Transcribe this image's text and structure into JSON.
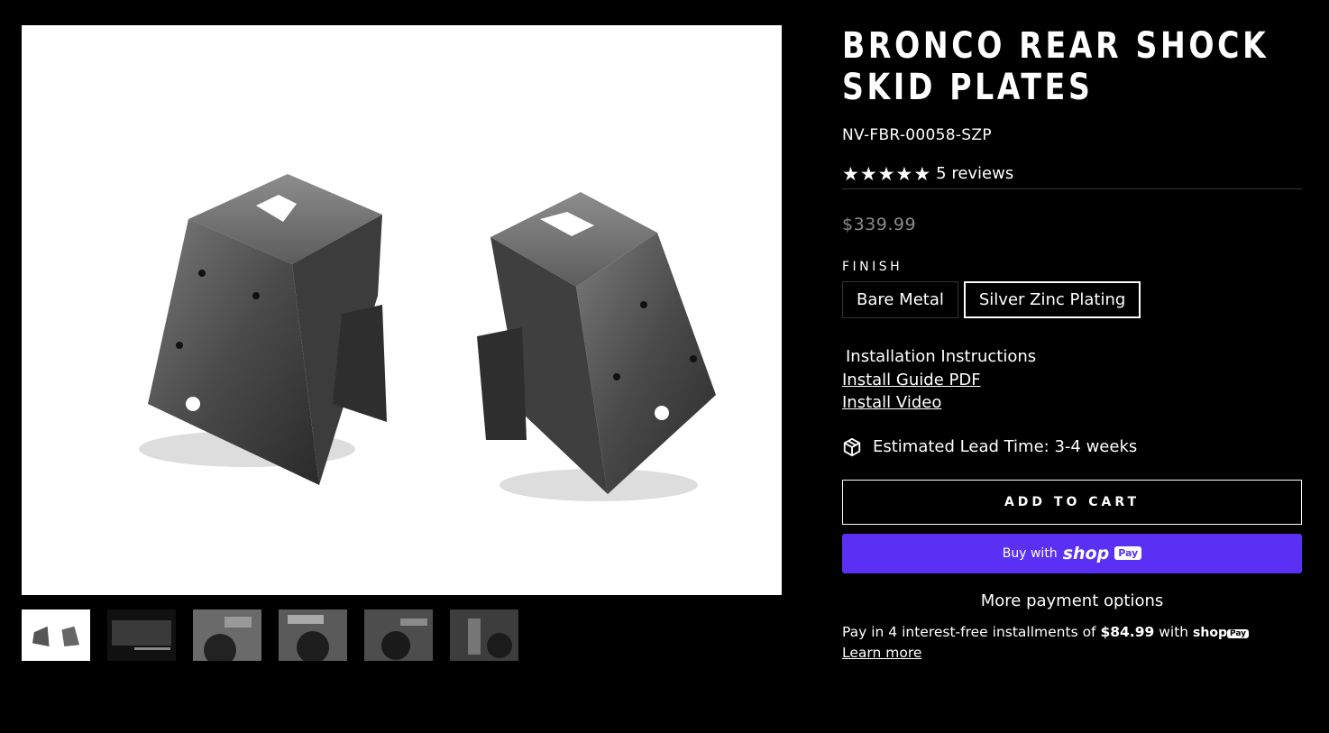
{
  "product": {
    "title": "BRONCO REAR SHOCK SKID PLATES",
    "sku": "NV-FBR-00058-SZP",
    "reviews_count": "5 reviews",
    "rating": 5,
    "price": "$339.99"
  },
  "finish": {
    "label": "FINISH",
    "options": [
      "Bare Metal",
      "Silver Zinc Plating"
    ],
    "selected": "Silver Zinc Plating"
  },
  "install": {
    "heading": "Installation Instructions",
    "guide_link": "Install Guide PDF",
    "video_link": "Install Video"
  },
  "lead_time": "Estimated Lead Time: 3-4 weeks",
  "buttons": {
    "add_to_cart": "ADD TO CART",
    "buy_with": "Buy with",
    "shop_brand": "shop",
    "pay_badge": "Pay",
    "more_payment": "More payment options"
  },
  "installments": {
    "prefix": "Pay in 4 interest-free installments of",
    "amount": "$84.99",
    "suffix": "with",
    "brand": "shop",
    "badge": "Pay",
    "learn_more": "Learn more"
  },
  "gallery": {
    "thumbnail_count": 6,
    "active_index": 0
  }
}
